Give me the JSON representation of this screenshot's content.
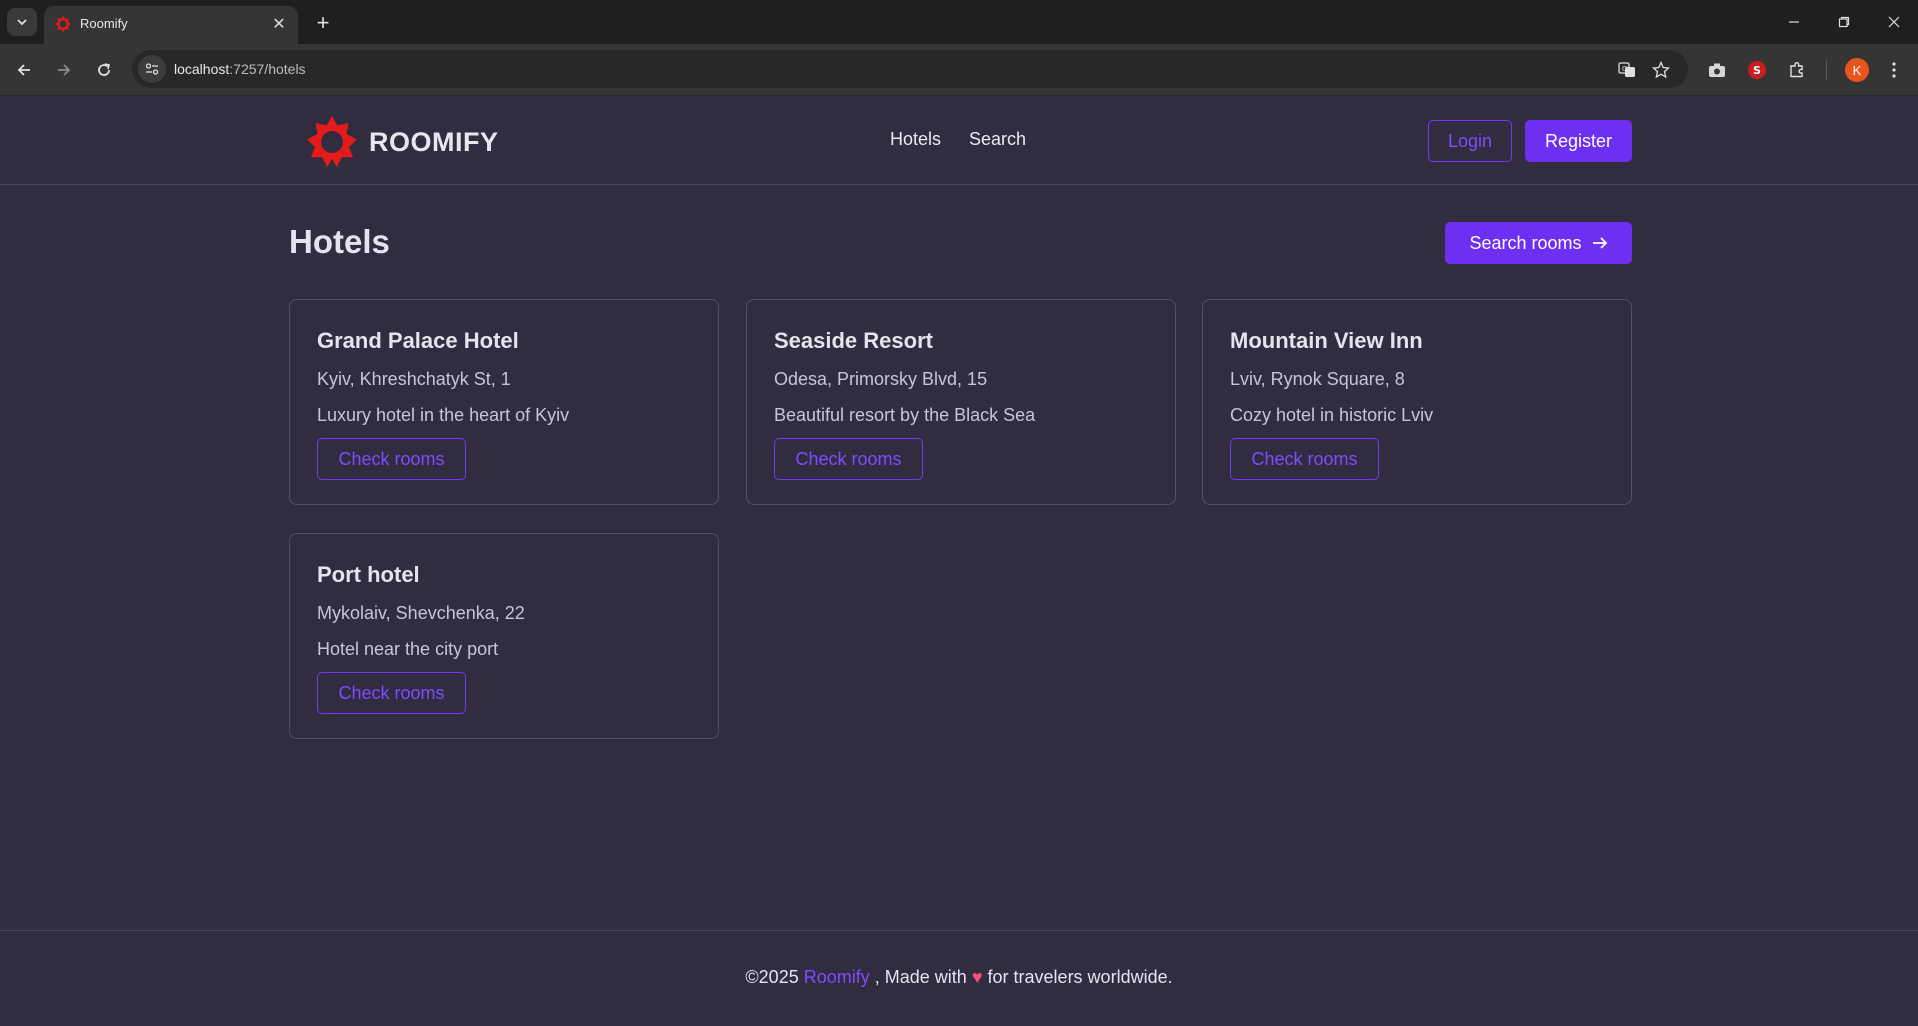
{
  "browser": {
    "tab_title": "Roomify",
    "url_host": "localhost",
    "url_path": ":7257/hotels",
    "profile_initial": "K"
  },
  "header": {
    "logo_text": "ROOMIFY",
    "nav": [
      "Hotels",
      "Search"
    ],
    "login_label": "Login",
    "register_label": "Register"
  },
  "main": {
    "title": "Hotels",
    "search_button_label": "Search rooms",
    "hotels": [
      {
        "name": "Grand Palace Hotel",
        "address": "Kyiv, Khreshchatyk St, 1",
        "description": "Luxury hotel in the heart of Kyiv",
        "button": "Check rooms"
      },
      {
        "name": "Seaside Resort",
        "address": "Odesa, Primorsky Blvd, 15",
        "description": "Beautiful resort by the Black Sea",
        "button": "Check rooms"
      },
      {
        "name": "Mountain View Inn",
        "address": "Lviv, Rynok Square, 8",
        "description": "Cozy hotel in historic Lviv",
        "button": "Check rooms"
      },
      {
        "name": "Port hotel",
        "address": "Mykolaiv, Shevchenka, 22",
        "description": "Hotel near the city port",
        "button": "Check rooms"
      }
    ]
  },
  "footer": {
    "prefix": "©2025",
    "brand": "Roomify",
    "middle": ", Made with",
    "suffix": "for travelers worldwide."
  },
  "colors": {
    "accent": "#6d2ff2",
    "background": "#312c3f",
    "logo_red": "#e41b1b"
  }
}
